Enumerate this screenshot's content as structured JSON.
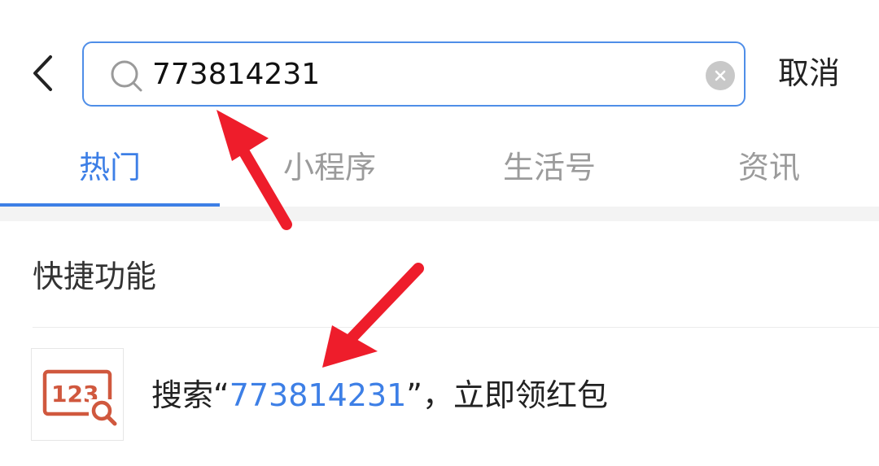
{
  "header": {
    "search_value": "773814231",
    "cancel_label": "取消"
  },
  "tabs": [
    {
      "label": "热门",
      "active": true
    },
    {
      "label": "小程序",
      "active": false
    },
    {
      "label": "生活号",
      "active": false
    },
    {
      "label": "资讯",
      "active": false
    }
  ],
  "section": {
    "title": "快捷功能",
    "item": {
      "prefix": "搜索“",
      "keyword": "773814231",
      "suffix": "”，立即领红包",
      "thumb_text": "123"
    }
  },
  "colors": {
    "accent": "#3d7fe6",
    "search_border": "#4f8ee8",
    "annotation_arrow": "#ee1d2b",
    "thumb_icon": "#d0583e"
  },
  "icons": {
    "back": "chevron-left-icon",
    "search": "search-icon",
    "clear": "clear-icon",
    "thumb": "number-search-icon"
  }
}
